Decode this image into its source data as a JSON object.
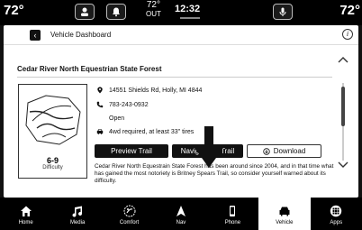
{
  "status": {
    "temp_left": "72°",
    "temp_right": "72°",
    "outside_temp": "72°",
    "outside_label": "OUT",
    "clock": "12:32"
  },
  "header": {
    "title": "Vehicle Dashboard",
    "info_icon": "info-icon"
  },
  "trail": {
    "name": "Cedar River North Equestrian State Forest",
    "address": "14551 Shields Rd, Holly, MI 4844",
    "phone": "783-243-0932",
    "status": "Open",
    "requirement": "4wd required, at least 33\" tires",
    "difficulty_value": "6-9",
    "difficulty_label": "Difficulty",
    "description": "Cedar River North Equestrain State Forest has been around since 2004, and in that time what has gained the most notoriety is Britney Spears Trail, so consider yourself warned about its difficulty."
  },
  "actions": {
    "preview": "Preview Trail",
    "navigate": "Navigate To Trail",
    "download": "Download"
  },
  "nav": {
    "items": [
      {
        "label": "Home",
        "icon": "home-icon"
      },
      {
        "label": "Media",
        "icon": "music-icon"
      },
      {
        "label": "Comfort",
        "icon": "comfort-icon"
      },
      {
        "label": "Nav",
        "icon": "nav-arrow-icon"
      },
      {
        "label": "Phone",
        "icon": "phone-icon"
      },
      {
        "label": "Vehicle",
        "icon": "vehicle-icon"
      },
      {
        "label": "Apps",
        "icon": "apps-grid-icon"
      }
    ],
    "active": "Vehicle"
  }
}
